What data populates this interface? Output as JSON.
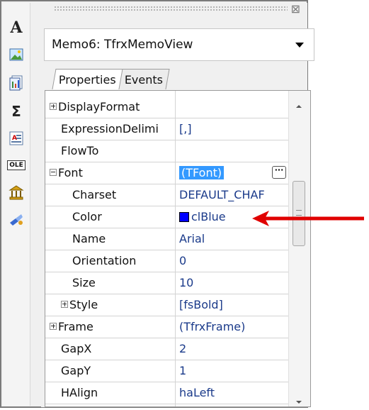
{
  "toolbar": {
    "items": [
      {
        "name": "text-tool",
        "glyph": "A"
      },
      {
        "name": "picture-tool",
        "glyph": ""
      },
      {
        "name": "subreport-tool",
        "glyph": ""
      },
      {
        "name": "sum-tool",
        "glyph": "Σ"
      },
      {
        "name": "richtext-tool",
        "glyph": ""
      },
      {
        "name": "ole-tool",
        "glyph": "OLE"
      },
      {
        "name": "bank-tool",
        "glyph": ""
      },
      {
        "name": "wizard-tool",
        "glyph": ""
      }
    ]
  },
  "inspector": {
    "object_selector": "Memo6: TfrxMemoView",
    "tabs": [
      {
        "label": "Properties",
        "active": true
      },
      {
        "label": "Events",
        "active": false
      }
    ],
    "rows": [
      {
        "name": "DisplayFormat",
        "value": "",
        "expander": "plus",
        "indent": 0
      },
      {
        "name": "ExpressionDelimi",
        "value": "[,]",
        "expander": "",
        "indent": 0
      },
      {
        "name": "FlowTo",
        "value": "",
        "expander": "",
        "indent": 0
      },
      {
        "name": "Font",
        "value": "(TFont)",
        "expander": "minus",
        "indent": 0,
        "selected": true,
        "has_ellipsis": true
      },
      {
        "name": "Charset",
        "value": "DEFAULT_CHAF",
        "expander": "",
        "indent": 1
      },
      {
        "name": "Color",
        "value": "clBlue",
        "expander": "",
        "indent": 1,
        "swatch": "#0000ff"
      },
      {
        "name": "Name",
        "value": "Arial",
        "expander": "",
        "indent": 1
      },
      {
        "name": "Orientation",
        "value": "0",
        "expander": "",
        "indent": 1
      },
      {
        "name": "Size",
        "value": "10",
        "expander": "",
        "indent": 1
      },
      {
        "name": "Style",
        "value": "[fsBold]",
        "expander": "plus",
        "indent": 1
      },
      {
        "name": "Frame",
        "value": "(TfrxFrame)",
        "expander": "plus",
        "indent": 0
      },
      {
        "name": "GapX",
        "value": "2",
        "expander": "",
        "indent": 0
      },
      {
        "name": "GapY",
        "value": "1",
        "expander": "",
        "indent": 0
      },
      {
        "name": "HAlign",
        "value": "haLeft",
        "expander": "",
        "indent": 0
      }
    ]
  },
  "colors": {
    "annotation_arrow": "#e00000",
    "selection": "#3399ff",
    "value_text": "#1a3a8a"
  }
}
